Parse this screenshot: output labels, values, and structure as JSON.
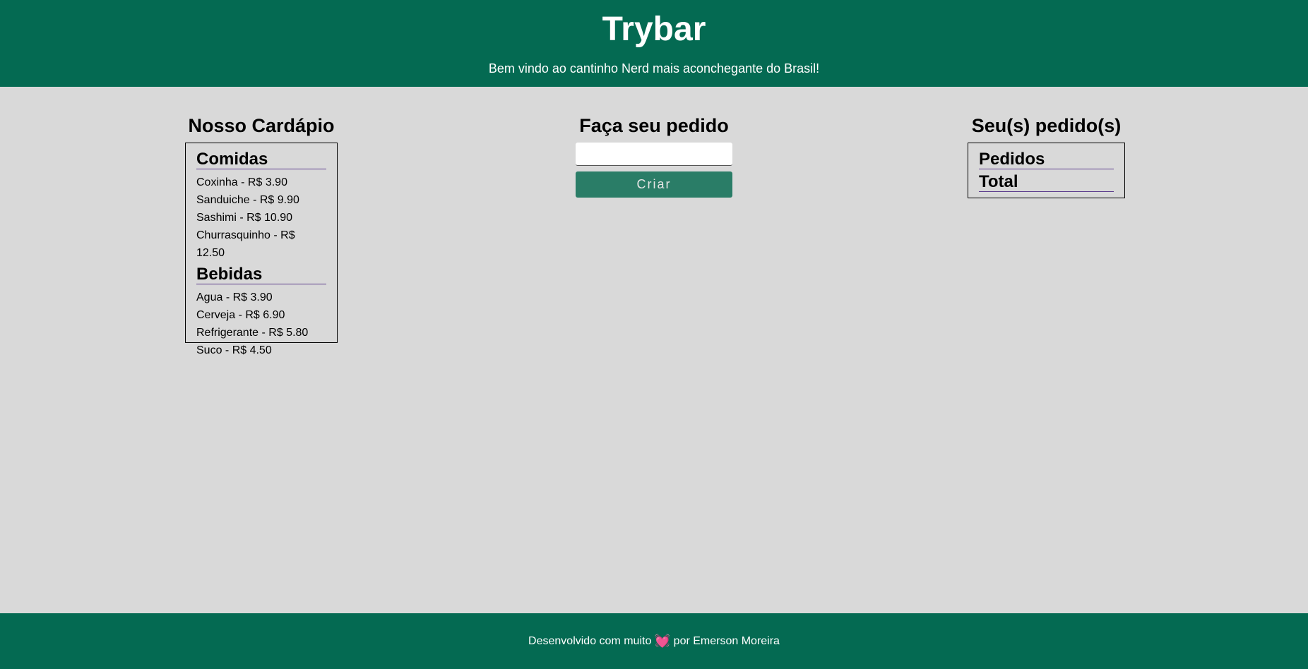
{
  "header": {
    "title": "Trybar",
    "subtitle": "Bem vindo ao cantinho Nerd mais aconchegante do Brasil!"
  },
  "menu": {
    "title": "Nosso Cardápio",
    "foods": {
      "label": "Comidas",
      "items": [
        "Coxinha - R$ 3.90",
        "Sanduiche - R$ 9.90",
        "Sashimi - R$ 10.90",
        "Churrasquinho - R$ 12.50"
      ]
    },
    "drinks": {
      "label": "Bebidas",
      "items": [
        "Agua - R$ 3.90",
        "Cerveja - R$ 6.90",
        "Refrigerante - R$ 5.80",
        "Suco - R$ 4.50"
      ]
    }
  },
  "order_form": {
    "title": "Faça seu pedido",
    "input_value": "",
    "button_label": "Criar"
  },
  "orders": {
    "title": "Seu(s) pedido(s)",
    "orders_label": "Pedidos",
    "total_label": "Total"
  },
  "footer": {
    "text_before": "Desenvolvido com muito",
    "heart_icon": "heart-icon",
    "text_after": "por Emerson Moreira"
  },
  "colors": {
    "header_bg": "#046a52",
    "page_bg": "#d9d9d9",
    "button_bg": "#2a7d67",
    "heading_underline": "#5b3a8c"
  }
}
